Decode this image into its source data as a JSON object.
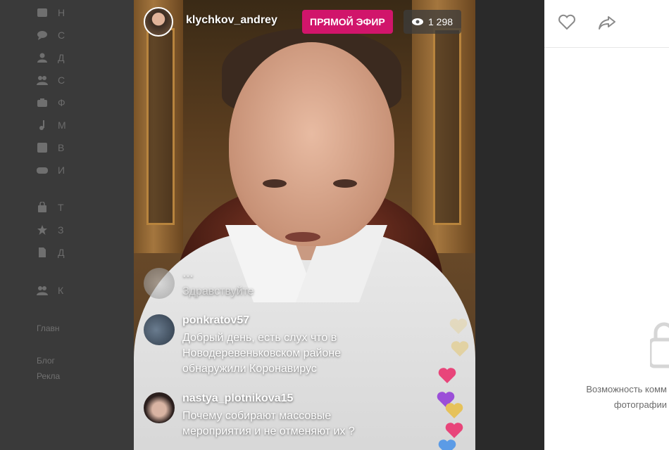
{
  "sidebar": {
    "items": [
      {
        "icon": "news-icon",
        "label": "Н"
      },
      {
        "icon": "messages-icon",
        "label": "С"
      },
      {
        "icon": "friends-icon",
        "label": "Д"
      },
      {
        "icon": "communities-icon",
        "label": "С"
      },
      {
        "icon": "photos-icon",
        "label": "Ф"
      },
      {
        "icon": "music-icon",
        "label": "М"
      },
      {
        "icon": "video-icon",
        "label": "В"
      },
      {
        "icon": "games-icon",
        "label": "И"
      },
      {
        "icon": "bag-icon",
        "label": "Т"
      },
      {
        "icon": "star-icon",
        "label": "З"
      },
      {
        "icon": "document-icon",
        "label": "Д"
      },
      {
        "icon": "group-icon",
        "label": "К"
      }
    ],
    "footer": {
      "main": "Главн",
      "blog": "Блог",
      "ads": "Рекла"
    }
  },
  "live": {
    "username": "klychkov_andrey",
    "badge": "ПРЯМОЙ ЭФИР",
    "viewers": "1 298"
  },
  "comments": [
    {
      "user": "…",
      "text": "Здравствуйте",
      "faded": true
    },
    {
      "user": "ponkratov57",
      "text": "Добрый день, есть слух что в Новодеревеньковском районе обнаружили Коронавирус"
    },
    {
      "user": "nastya_plotnikova15",
      "text": "Почему собирают массовые мероприятия и не отменяют их ?"
    }
  ],
  "right_panel": {
    "message_line1": "Возможность комм",
    "message_line2": "фотографии"
  },
  "colors": {
    "live_badge": "#d1156b",
    "heart_pink": "#e8457a",
    "heart_purple": "#9b4fd8",
    "heart_yellow": "#e6c25a",
    "heart_blue": "#5b9be6"
  }
}
